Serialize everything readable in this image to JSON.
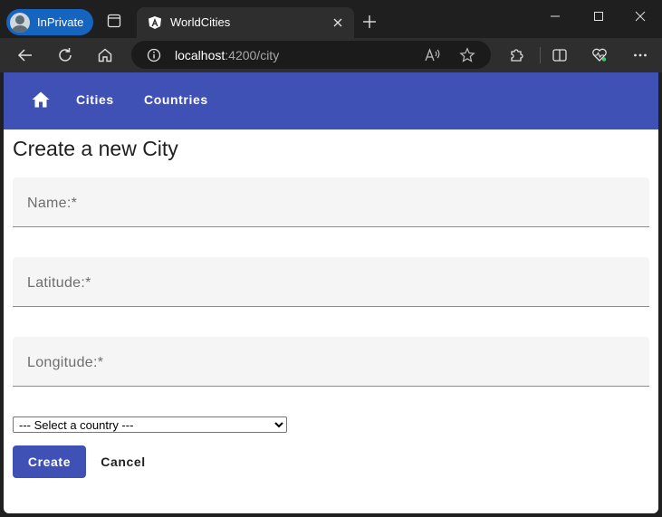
{
  "browser": {
    "inprivate_label": "InPrivate",
    "tab_title": "WorldCities",
    "url_host": "localhost",
    "url_path": ":4200/city"
  },
  "app": {
    "nav": {
      "cities_label": "Cities",
      "countries_label": "Countries"
    },
    "page_title": "Create a new City",
    "form": {
      "name_label": "Name:*",
      "latitude_label": "Latitude:*",
      "longitude_label": "Longitude:*",
      "country_select_value": "--- Select a country ---",
      "create_label": "Create",
      "cancel_label": "Cancel"
    }
  },
  "colors": {
    "primary": "#3f51b5",
    "inprivate_badge": "#1565c0",
    "field_background": "#f5f5f5"
  },
  "icons": {
    "tabstrip": [
      "avatar-icon",
      "tab-actions-icon",
      "angular-favicon-icon",
      "close-icon",
      "new-tab-icon",
      "minimize-icon",
      "maximize-icon",
      "close-window-icon"
    ],
    "toolbar": [
      "back-icon",
      "refresh-icon",
      "home-icon",
      "info-icon",
      "read-aloud-icon",
      "favorite-star-icon",
      "extensions-icon",
      "split-screen-icon",
      "browser-essentials-icon",
      "more-icon"
    ],
    "app": [
      "home-icon"
    ]
  }
}
